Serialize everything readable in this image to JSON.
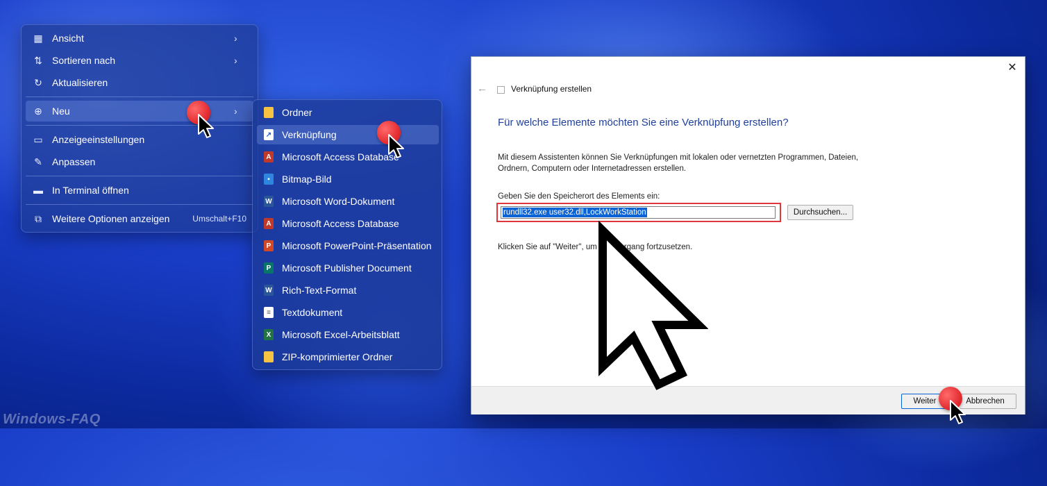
{
  "context_menu": {
    "items": [
      {
        "label": "Ansicht",
        "icon": "grid-icon",
        "submenu": true
      },
      {
        "label": "Sortieren nach",
        "icon": "sort-icon",
        "submenu": true
      },
      {
        "label": "Aktualisieren",
        "icon": "refresh-icon",
        "submenu": false
      },
      {
        "label": "Neu",
        "icon": "plus-circle-icon",
        "submenu": true
      },
      {
        "label": "Anzeigeeinstellungen",
        "icon": "display-icon",
        "submenu": false
      },
      {
        "label": "Anpassen",
        "icon": "pen-icon",
        "submenu": false
      },
      {
        "label": "In Terminal öffnen",
        "icon": "terminal-icon",
        "submenu": false
      },
      {
        "label": "Weitere Optionen anzeigen",
        "icon": "more-options-icon",
        "shortcut": "Umschalt+F10"
      }
    ]
  },
  "submenu": {
    "items": [
      {
        "label": "Ordner",
        "icon": "folder-icon",
        "color": "#f6c342"
      },
      {
        "label": "Verknüpfung",
        "icon": "shortcut-icon",
        "color": "#ffffff"
      },
      {
        "label": "Microsoft Access Database",
        "icon": "access-icon",
        "color": "#c0392b"
      },
      {
        "label": "Bitmap-Bild",
        "icon": "bitmap-icon",
        "color": "#2e86de"
      },
      {
        "label": "Microsoft Word-Dokument",
        "icon": "word-icon",
        "color": "#2b579a"
      },
      {
        "label": "Microsoft Access Database",
        "icon": "access-icon",
        "color": "#c0392b"
      },
      {
        "label": "Microsoft PowerPoint-Präsentation",
        "icon": "powerpoint-icon",
        "color": "#d24726"
      },
      {
        "label": "Microsoft Publisher Document",
        "icon": "publisher-icon",
        "color": "#077568"
      },
      {
        "label": "Rich-Text-Format",
        "icon": "rtf-icon",
        "color": "#2b579a"
      },
      {
        "label": "Textdokument",
        "icon": "text-icon",
        "color": "#ffffff"
      },
      {
        "label": "Microsoft Excel-Arbeitsblatt",
        "icon": "excel-icon",
        "color": "#217346"
      },
      {
        "label": "ZIP-komprimierter Ordner",
        "icon": "zip-icon",
        "color": "#f6c342"
      }
    ]
  },
  "dialog": {
    "title": "Verknüpfung erstellen",
    "heading": "Für welche Elemente möchten Sie eine Verknüpfung erstellen?",
    "description": "Mit diesem Assistenten können Sie Verknüpfungen mit lokalen oder vernetzten Programmen, Dateien, Ordnern, Computern oder Internetadressen erstellen.",
    "location_label": "Geben Sie den Speicherort des Elements ein:",
    "location_value": "rundll32.exe user32.dll,LockWorkStation",
    "browse_label": "Durchsuchen...",
    "hint": "Klicken Sie auf \"Weiter\", um den Vorgang fortzusetzen.",
    "next_label": "Weiter",
    "cancel_label": "Abbrechen"
  },
  "watermark": "Windows-FAQ"
}
